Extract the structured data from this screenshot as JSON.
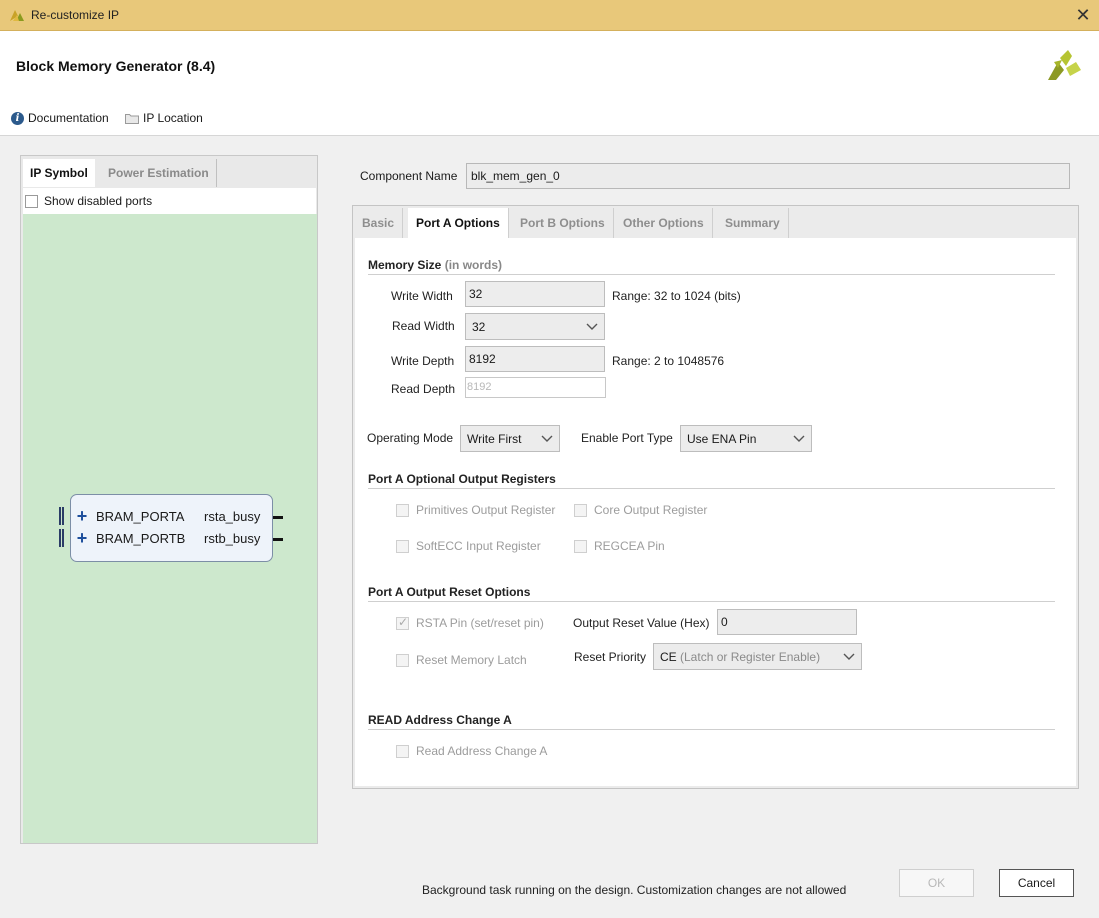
{
  "window": {
    "title": "Re-customize IP",
    "close_glyph": "✕"
  },
  "header": {
    "ip_title": "Block Memory Generator (8.4)",
    "documentation_label": "Documentation",
    "ip_location_label": "IP Location",
    "info_glyph": "i"
  },
  "left_panel": {
    "tabs": [
      {
        "label": "IP Symbol",
        "active": true
      },
      {
        "label": "Power Estimation",
        "active": false
      }
    ],
    "show_disabled_ports_label": "Show disabled ports",
    "symbol": {
      "ports": [
        {
          "name": "BRAM_PORTA",
          "signal": "rsta_busy"
        },
        {
          "name": "BRAM_PORTB",
          "signal": "rstb_busy"
        }
      ],
      "background_color": "#cde8cd"
    }
  },
  "component": {
    "label": "Component Name",
    "value": "blk_mem_gen_0"
  },
  "tabs": [
    {
      "label": "Basic",
      "active": false
    },
    {
      "label": "Port A Options",
      "active": true
    },
    {
      "label": "Port B Options",
      "active": false
    },
    {
      "label": "Other Options",
      "active": false
    },
    {
      "label": "Summary",
      "active": false
    }
  ],
  "memory_size": {
    "title": "Memory Size",
    "title_sub": "(in words)",
    "write_width_label": "Write Width",
    "write_width_value": "32",
    "write_width_range": "Range: 32 to 1024 (bits)",
    "read_width_label": "Read Width",
    "read_width_value": "32",
    "write_depth_label": "Write Depth",
    "write_depth_value": "8192",
    "write_depth_range": "Range: 2 to 1048576",
    "read_depth_label": "Read Depth",
    "read_depth_value": "8192"
  },
  "modes": {
    "operating_mode_label": "Operating Mode",
    "operating_mode_value": "Write First",
    "enable_port_type_label": "Enable Port Type",
    "enable_port_type_value": "Use ENA Pin"
  },
  "optional_output_registers": {
    "title": "Port A Optional Output Registers",
    "primitives": "Primitives Output Register",
    "core": "Core Output Register",
    "softecc": "SoftECC Input Register",
    "regcea": "REGCEA Pin"
  },
  "reset_options": {
    "title": "Port A Output Reset Options",
    "rsta_pin": "RSTA Pin (set/reset pin)",
    "output_reset_value_label": "Output Reset Value (Hex)",
    "output_reset_value": "0",
    "reset_memory_latch": "Reset Memory Latch",
    "reset_priority_label": "Reset Priority",
    "reset_priority_value": "CE",
    "reset_priority_detail": "(Latch or Register Enable)"
  },
  "read_address_change": {
    "title": "READ Address Change A",
    "checkbox": "Read Address Change A"
  },
  "footer": {
    "status": "Background task running on the design. Customization changes are not allowed",
    "ok_label": "OK",
    "cancel_label": "Cancel"
  },
  "colors": {
    "titlebar": "#e8c87a",
    "xilinx_logo": "#a7b52a",
    "port_plus": "#1e4f9c"
  }
}
